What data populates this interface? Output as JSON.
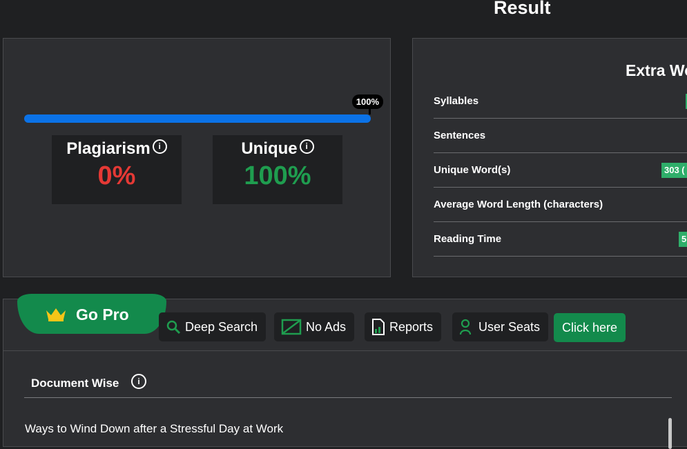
{
  "page": {
    "title": "Result"
  },
  "scores": {
    "progress_label": "100%",
    "progress_fraction": 1.0,
    "plagiarism": {
      "label": "Plagiarism",
      "value": "0%"
    },
    "unique": {
      "label": "Unique",
      "value": "100%"
    }
  },
  "extra": {
    "title": "Extra Wo",
    "rows": [
      {
        "label": "Syllables",
        "badge": ""
      },
      {
        "label": "Sentences",
        "badge": ""
      },
      {
        "label": "Unique Word(s)",
        "badge": "303 ("
      },
      {
        "label": "Average Word Length (characters)",
        "badge": ""
      },
      {
        "label": "Reading Time",
        "badge": "5"
      }
    ]
  },
  "pro": {
    "go_pro": "Go Pro",
    "features": {
      "deep_search": "Deep Search",
      "no_ads": "No Ads",
      "reports": "Reports",
      "user_seats": "User Seats"
    },
    "cta": "Click here"
  },
  "document": {
    "heading": "Document Wise",
    "info_glyph": "i",
    "first_line": "Ways to Wind Down after a Stressful Day at Work"
  },
  "colors": {
    "accent_blue": "#0b72e7",
    "accent_green": "#138a4c",
    "badge_green": "#2fae6a",
    "danger_red": "#e53935"
  }
}
